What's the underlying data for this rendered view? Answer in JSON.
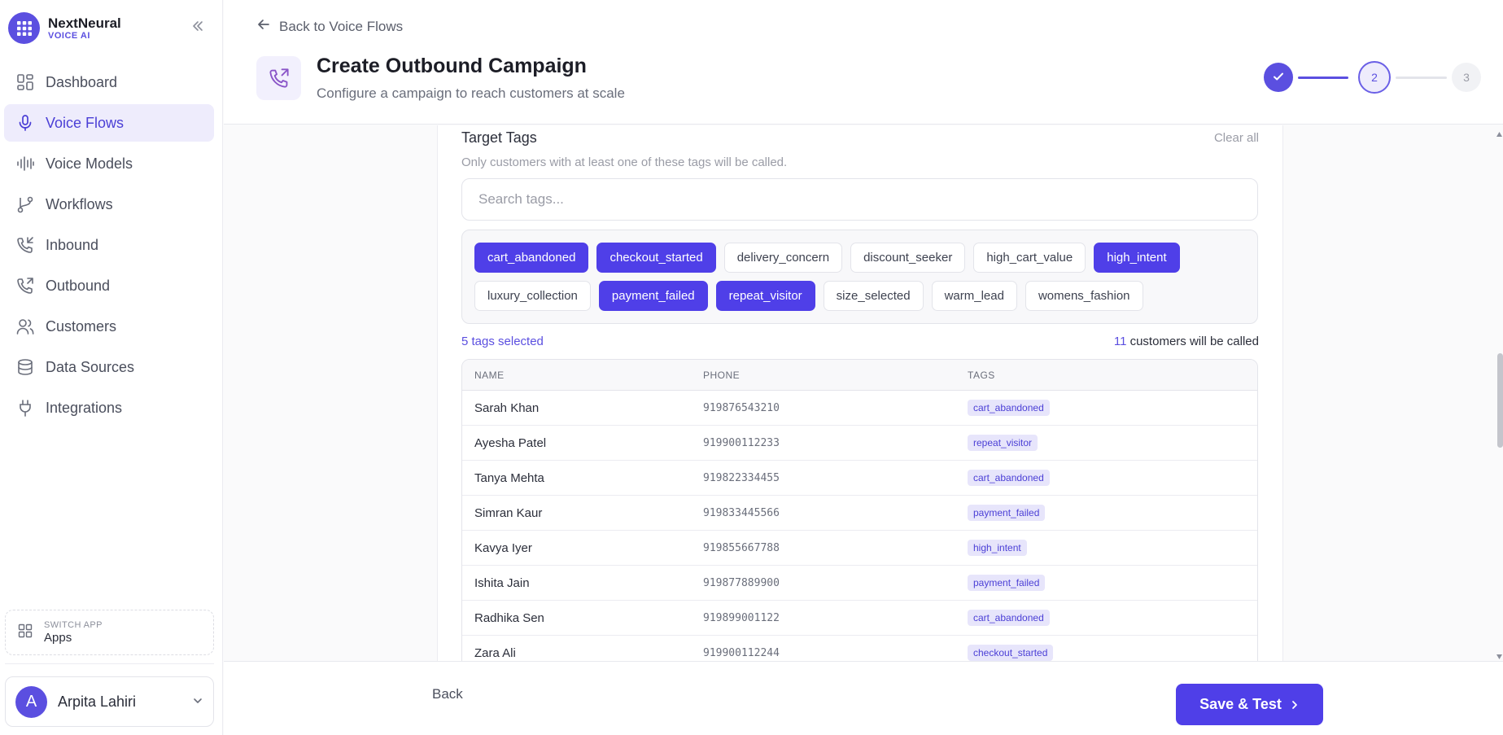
{
  "brand": {
    "name": "NextNeural",
    "sub": "VOICE AI"
  },
  "sidebar": {
    "items": [
      {
        "label": "Dashboard",
        "icon": "dashboard-icon",
        "active": false
      },
      {
        "label": "Voice Flows",
        "icon": "microphone-icon",
        "active": true
      },
      {
        "label": "Voice Models",
        "icon": "waveform-icon",
        "active": false
      },
      {
        "label": "Workflows",
        "icon": "workflow-icon",
        "active": false
      },
      {
        "label": "Inbound",
        "icon": "phone-incoming-icon",
        "active": false
      },
      {
        "label": "Outbound",
        "icon": "phone-outgoing-icon",
        "active": false
      },
      {
        "label": "Customers",
        "icon": "users-icon",
        "active": false
      },
      {
        "label": "Data Sources",
        "icon": "database-icon",
        "active": false
      },
      {
        "label": "Integrations",
        "icon": "plug-icon",
        "active": false
      }
    ],
    "switch_app": {
      "caption": "SWITCH APP",
      "label": "Apps"
    },
    "user": {
      "initial": "A",
      "name": "Arpita Lahiri"
    }
  },
  "header": {
    "back_label": "Back to Voice Flows",
    "title": "Create Outbound Campaign",
    "subtitle": "Configure a campaign to reach customers at scale",
    "steps": [
      "",
      "2",
      "3"
    ]
  },
  "target_tags": {
    "title": "Target Tags",
    "clear_all": "Clear all",
    "description": "Only customers with at least one of these tags will be called.",
    "search_placeholder": "Search tags...",
    "tags_row1": [
      {
        "label": "cart_abandoned",
        "selected": true
      },
      {
        "label": "checkout_started",
        "selected": true
      },
      {
        "label": "delivery_concern",
        "selected": false
      },
      {
        "label": "discount_seeker",
        "selected": false
      },
      {
        "label": "high_cart_value",
        "selected": false
      },
      {
        "label": "high_intent",
        "selected": true
      }
    ],
    "tags_row2": [
      {
        "label": "luxury_collection",
        "selected": false
      },
      {
        "label": "payment_failed",
        "selected": true
      },
      {
        "label": "repeat_visitor",
        "selected": true
      },
      {
        "label": "size_selected",
        "selected": false
      },
      {
        "label": "warm_lead",
        "selected": false
      },
      {
        "label": "womens_fashion",
        "selected": false
      }
    ],
    "selected_text": "5 tags selected",
    "customers_count": "11",
    "customers_text": "customers will be called"
  },
  "table": {
    "headers": [
      "NAME",
      "PHONE",
      "TAGS"
    ],
    "rows": [
      {
        "name": "Sarah Khan",
        "phone": "919876543210",
        "tag": "cart_abandoned"
      },
      {
        "name": "Ayesha Patel",
        "phone": "919900112233",
        "tag": "repeat_visitor"
      },
      {
        "name": "Tanya Mehta",
        "phone": "919822334455",
        "tag": "cart_abandoned"
      },
      {
        "name": "Simran Kaur",
        "phone": "919833445566",
        "tag": "payment_failed"
      },
      {
        "name": "Kavya Iyer",
        "phone": "919855667788",
        "tag": "high_intent"
      },
      {
        "name": "Ishita Jain",
        "phone": "919877889900",
        "tag": "payment_failed"
      },
      {
        "name": "Radhika Sen",
        "phone": "919899001122",
        "tag": "cart_abandoned"
      },
      {
        "name": "Zara Ali",
        "phone": "919900112244",
        "tag": "checkout_started"
      }
    ]
  },
  "footer": {
    "back_label": "Back",
    "save_label": "Save & Test"
  },
  "colors": {
    "accent": "#4f3fe8",
    "accent_soft": "#eeecfc"
  }
}
